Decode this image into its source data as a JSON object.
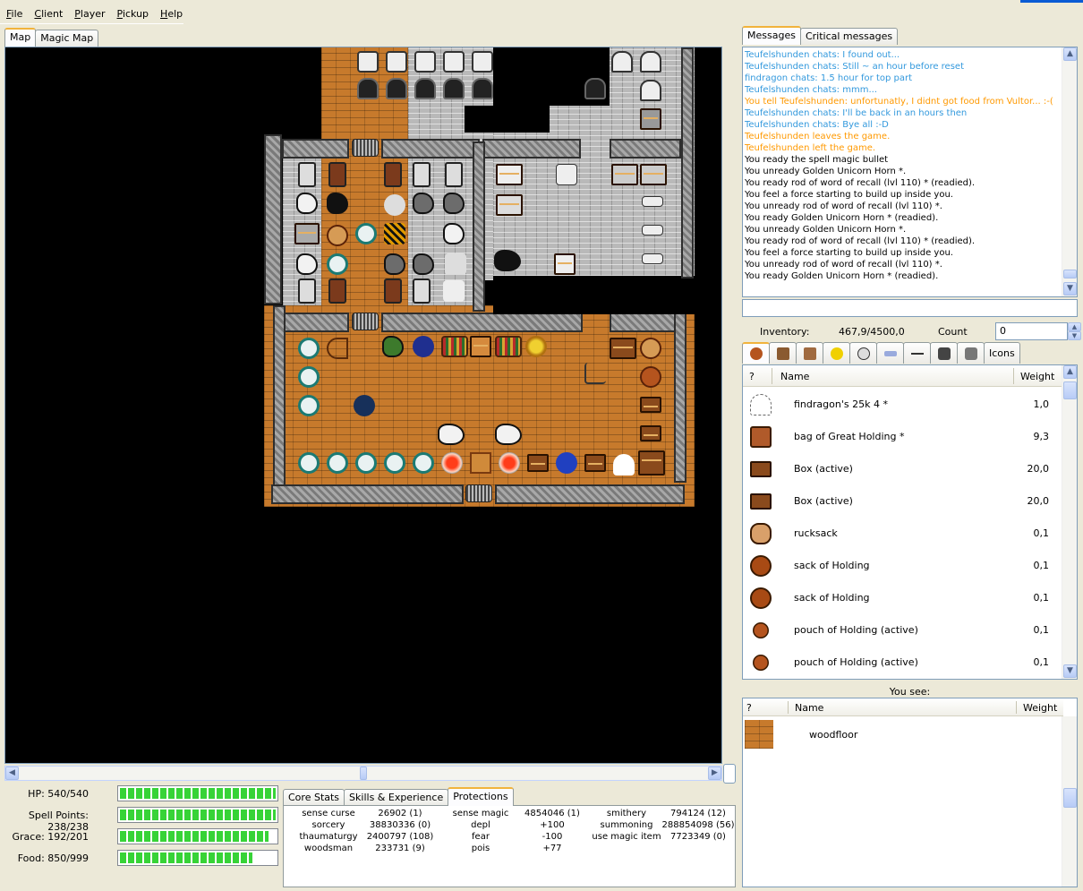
{
  "menu": [
    "File",
    "Client",
    "Player",
    "Pickup",
    "Help"
  ],
  "map_tabs": [
    "Map",
    "Magic Map"
  ],
  "vitals": [
    {
      "label": "HP:",
      "value": "540/540",
      "fraction": 1.0
    },
    {
      "label": "Spell Points:",
      "value": "238/238",
      "fraction": 1.0
    },
    {
      "label": "Grace:",
      "value": "192/201",
      "fraction": 0.955
    },
    {
      "label": "Food:",
      "value": "850/999",
      "fraction": 0.851
    }
  ],
  "stat_tabs": [
    "Core Stats",
    "Skills & Experience",
    "Protections"
  ],
  "protections": [
    [
      "sense curse",
      "26902 (1)",
      "sense magic",
      "4854046 (1)",
      "smithery",
      "794124 (12)"
    ],
    [
      "sorcery",
      "38830336 (0)",
      "depl",
      "+100",
      "summoning",
      "288854098 (56)"
    ],
    [
      "thaumaturgy",
      "2400797 (108)",
      "fear",
      "-100",
      "use magic item",
      "7723349 (0)"
    ],
    [
      "woodsman",
      "233731 (9)",
      "pois",
      "+77",
      "",
      ""
    ]
  ],
  "msg_tabs": [
    "Messages",
    "Critical messages"
  ],
  "messages": [
    {
      "text": "Teufelshunden chats: I found out...",
      "color": "#3399dd"
    },
    {
      "text": "Teufelshunden chats: Still ~ an hour before reset",
      "color": "#3399dd"
    },
    {
      "text": "findragon chats: 1.5 hour for top part",
      "color": "#3399dd"
    },
    {
      "text": "Teufelshunden chats: mmm...",
      "color": "#3399dd"
    },
    {
      "text": "You tell Teufelshunden: unfortunatly, I didnt got food from Vultor... :-(",
      "color": "#ff9900"
    },
    {
      "text": "Teufelshunden chats: I'll be back in an hours then",
      "color": "#3399dd"
    },
    {
      "text": "Teufelshunden chats: Bye all :-D",
      "color": "#3399dd"
    },
    {
      "text": "Teufelshunden leaves the game.",
      "color": "#ff9900"
    },
    {
      "text": "Teufelshunden left the game.",
      "color": "#ff9900"
    },
    {
      "text": "You ready the spell magic bullet",
      "color": "#000000"
    },
    {
      "text": "You unready Golden Unicorn Horn *.",
      "color": "#000000"
    },
    {
      "text": "You ready rod of word of recall (lvl 110) * (readied).",
      "color": "#000000"
    },
    {
      "text": "You feel a force starting to build up inside you.",
      "color": "#000000"
    },
    {
      "text": "You unready rod of word of recall (lvl 110) *.",
      "color": "#000000"
    },
    {
      "text": "You ready Golden Unicorn Horn * (readied).",
      "color": "#000000"
    },
    {
      "text": "You unready Golden Unicorn Horn *.",
      "color": "#000000"
    },
    {
      "text": "You ready rod of word of recall (lvl 110) * (readied).",
      "color": "#000000"
    },
    {
      "text": "You feel a force starting to build up inside you.",
      "color": "#000000"
    },
    {
      "text": "You unready rod of word of recall (lvl 110) *.",
      "color": "#000000"
    },
    {
      "text": "You ready Golden Unicorn Horn * (readied).",
      "color": "#000000"
    }
  ],
  "inventory": {
    "label": "Inventory:",
    "weight": "467,9/4500,0",
    "count_label": "Count",
    "count_value": "0",
    "icons_tab": "Icons",
    "columns": [
      "?",
      "Name",
      "Weight"
    ],
    "items": [
      {
        "name": "findragon's 25k 4  *",
        "weight": "1,0",
        "icon": "scroll-icon"
      },
      {
        "name": "bag of Great Holding  *",
        "weight": "9,3",
        "icon": "bag-icon"
      },
      {
        "name": "Box  (active)",
        "weight": "20,0",
        "icon": "chest-icon"
      },
      {
        "name": "Box  (active)",
        "weight": "20,0",
        "icon": "chest-icon"
      },
      {
        "name": "rucksack",
        "weight": "0,1",
        "icon": "rucksack-icon"
      },
      {
        "name": "sack of Holding",
        "weight": "0,1",
        "icon": "sack-icon"
      },
      {
        "name": "sack of Holding",
        "weight": "0,1",
        "icon": "sack-icon"
      },
      {
        "name": "pouch of Holding  (active)",
        "weight": "0,1",
        "icon": "pouch-icon"
      },
      {
        "name": "pouch of Holding  (active)",
        "weight": "0,1",
        "icon": "pouch-icon"
      }
    ]
  },
  "ground": {
    "label": "You see:",
    "columns": [
      "?",
      "Name",
      "Weight"
    ],
    "items": [
      {
        "name": "woodfloor",
        "weight": "",
        "icon": "woodfloor-icon"
      }
    ]
  }
}
